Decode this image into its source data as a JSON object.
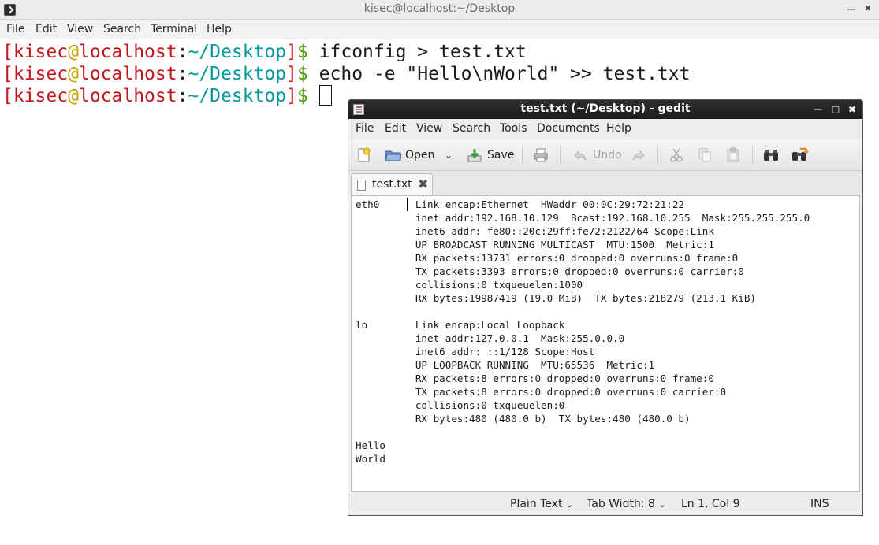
{
  "terminal": {
    "title": "kisec@localhost:~/Desktop",
    "menu": [
      "File",
      "Edit",
      "View",
      "Search",
      "Terminal",
      "Help"
    ],
    "prompt": {
      "open_bracket": "[",
      "user": "kisec",
      "at": "@",
      "host": "localhost",
      "colon": ":",
      "path": "~/Desktop",
      "close_bracket": "]",
      "dollar": "$"
    },
    "commands": [
      "ifconfig > test.txt",
      "echo -e \"Hello\\nWorld\" >> test.txt",
      ""
    ]
  },
  "gedit": {
    "title": "test.txt (~/Desktop) - gedit",
    "menu": [
      "File",
      "Edit",
      "View",
      "Search",
      "Tools",
      "Documents",
      "Help"
    ],
    "toolbar": {
      "open_label": "Open",
      "save_label": "Save",
      "undo_label": "Undo",
      "icons": [
        "new-document-icon",
        "open-folder-icon",
        "save-icon",
        "print-icon",
        "undo-icon",
        "redo-icon",
        "cut-icon",
        "copy-icon",
        "paste-icon",
        "find-icon",
        "replace-icon"
      ]
    },
    "tab": {
      "label": "test.txt"
    },
    "content_lines": [
      "eth0      Link encap:Ethernet  HWaddr 00:0C:29:72:21:22",
      "          inet addr:192.168.10.129  Bcast:192.168.10.255  Mask:255.255.255.0",
      "          inet6 addr: fe80::20c:29ff:fe72:2122/64 Scope:Link",
      "          UP BROADCAST RUNNING MULTICAST  MTU:1500  Metric:1",
      "          RX packets:13731 errors:0 dropped:0 overruns:0 frame:0",
      "          TX packets:3393 errors:0 dropped:0 overruns:0 carrier:0",
      "          collisions:0 txqueuelen:1000",
      "          RX bytes:19987419 (19.0 MiB)  TX bytes:218279 (213.1 KiB)",
      "",
      "lo        Link encap:Local Loopback",
      "          inet addr:127.0.0.1  Mask:255.0.0.0",
      "          inet6 addr: ::1/128 Scope:Host",
      "          UP LOOPBACK RUNNING  MTU:65536  Metric:1",
      "          RX packets:8 errors:0 dropped:0 overruns:0 frame:0",
      "          TX packets:8 errors:0 dropped:0 overruns:0 carrier:0",
      "          collisions:0 txqueuelen:0",
      "          RX bytes:480 (480.0 b)  TX bytes:480 (480.0 b)",
      "",
      "Hello",
      "World"
    ],
    "status": {
      "language": "Plain Text",
      "tab_width_label": "Tab Width:",
      "tab_width_value": "8",
      "position": "Ln 1, Col 9",
      "mode": "INS"
    }
  }
}
